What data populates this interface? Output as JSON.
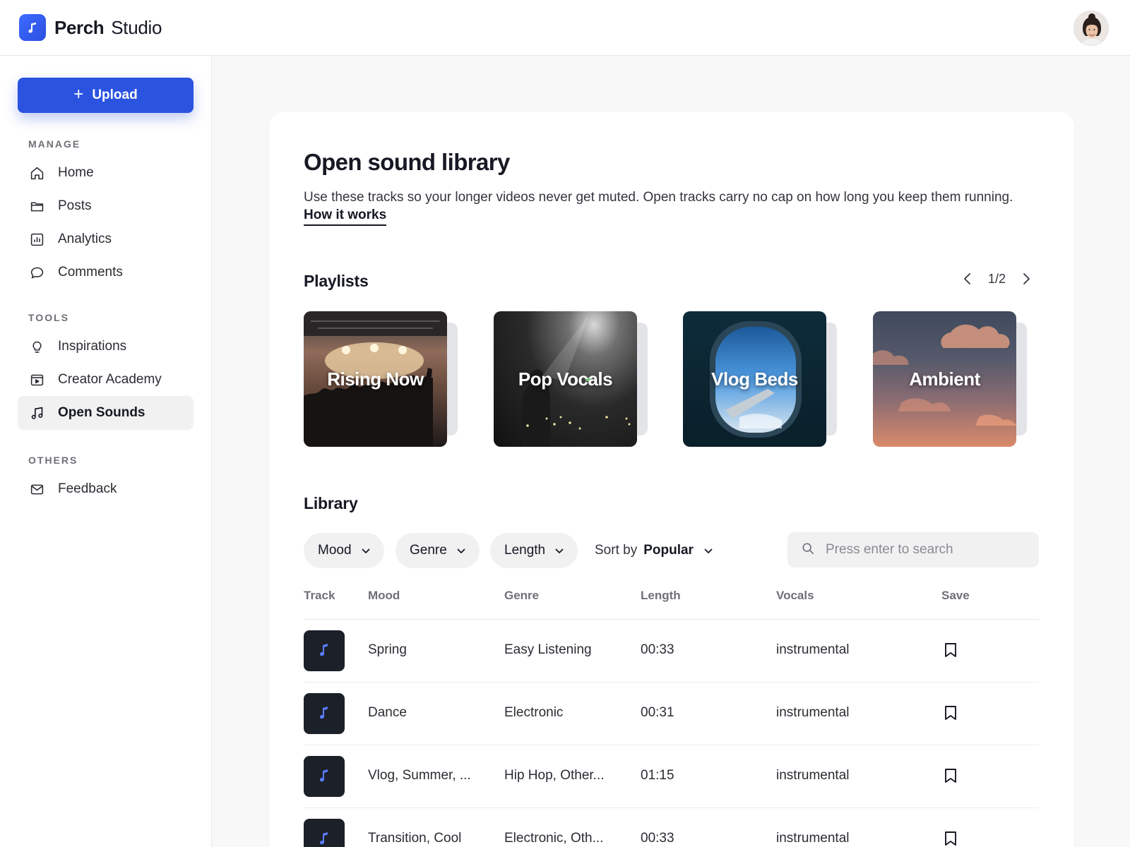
{
  "app": {
    "brand_bold": "Perch",
    "brand_light": "Studio"
  },
  "sidebar": {
    "upload_label": "Upload",
    "sections": {
      "manage": "MANAGE",
      "tools": "TOOLS",
      "others": "OTHERS"
    },
    "items": [
      {
        "label": "Home",
        "icon": "home-icon",
        "active": false
      },
      {
        "label": "Posts",
        "icon": "folder-icon",
        "active": false
      },
      {
        "label": "Analytics",
        "icon": "analytics-icon",
        "active": false
      },
      {
        "label": "Comments",
        "icon": "comment-icon",
        "active": false
      },
      {
        "label": "Inspirations",
        "icon": "lightbulb-icon",
        "active": false
      },
      {
        "label": "Creator Academy",
        "icon": "video-play-icon",
        "active": false
      },
      {
        "label": "Open Sounds",
        "icon": "music-note-icon",
        "active": true
      },
      {
        "label": "Feedback",
        "icon": "mail-icon",
        "active": false
      }
    ]
  },
  "main": {
    "title": "Open sound library",
    "description": "Use these tracks so your longer videos never get muted. Open tracks carry no cap on how long you keep them running.",
    "how_link": "How it works",
    "playlists": {
      "title": "Playlists",
      "page": "1/2",
      "items": [
        {
          "title": "Rising Now"
        },
        {
          "title": "Pop Vocals"
        },
        {
          "title": "Vlog Beds"
        },
        {
          "title": "Ambient"
        }
      ]
    },
    "library": {
      "title": "Library",
      "filters": {
        "mood": "Mood",
        "genre": "Genre",
        "length": "Length"
      },
      "sort_prefix": "Sort by",
      "sort_value": "Popular",
      "search_placeholder": "Press enter to search",
      "columns": [
        "Track",
        "Mood",
        "Genre",
        "Length",
        "Vocals",
        "Save"
      ],
      "rows": [
        {
          "mood": "Spring",
          "genre": "Easy Listening",
          "length": "00:33",
          "vocals": "instrumental"
        },
        {
          "mood": "Dance",
          "genre": "Electronic",
          "length": "00:31",
          "vocals": "instrumental"
        },
        {
          "mood": "Vlog, Summer, ...",
          "genre": "Hip Hop, Other...",
          "length": "01:15",
          "vocals": "instrumental"
        },
        {
          "mood": "Transition, Cool",
          "genre": "Electronic, Oth...",
          "length": "00:33",
          "vocals": "instrumental"
        }
      ]
    }
  },
  "colors": {
    "accent": "#2a53e0",
    "note_icon": "#5b7cff",
    "thumb_bg": "#1c2029"
  }
}
